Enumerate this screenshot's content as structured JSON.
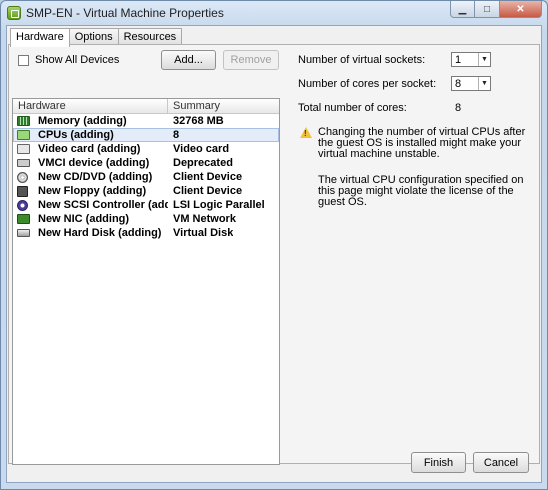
{
  "window": {
    "title": "SMP-EN - Virtual Machine Properties"
  },
  "tabs": [
    {
      "label": "Hardware"
    },
    {
      "label": "Options"
    },
    {
      "label": "Resources"
    }
  ],
  "hardware": {
    "show_all_devices_label": "Show All Devices",
    "add_button": "Add...",
    "remove_button": "Remove",
    "columns": {
      "hardware": "Hardware",
      "summary": "Summary"
    },
    "devices": [
      {
        "name": "Memory (adding)",
        "summary": "32768 MB",
        "icon": "memory-icon"
      },
      {
        "name": "CPUs (adding)",
        "summary": "8",
        "icon": "cpu-icon"
      },
      {
        "name": "Video card  (adding)",
        "summary": "Video card",
        "icon": "video-card-icon"
      },
      {
        "name": "VMCI device (adding)",
        "summary": "Deprecated",
        "icon": "vmci-device-icon"
      },
      {
        "name": "New CD/DVD (adding)",
        "summary": "Client Device",
        "icon": "cd-dvd-icon"
      },
      {
        "name": "New Floppy (adding)",
        "summary": "Client Device",
        "icon": "floppy-icon"
      },
      {
        "name": "New SCSI Controller (add...",
        "summary": "LSI Logic Parallel",
        "icon": "scsi-controller-icon"
      },
      {
        "name": "New NIC (adding)",
        "summary": "VM Network",
        "icon": "nic-icon"
      },
      {
        "name": "New Hard Disk (adding)",
        "summary": "Virtual Disk",
        "icon": "hard-disk-icon"
      }
    ]
  },
  "cpu_settings": {
    "sockets_label": "Number of virtual sockets:",
    "sockets_value": "1",
    "cores_label": "Number of cores per socket:",
    "cores_value": "8",
    "total_label": "Total number of cores:",
    "total_value": "8",
    "warning_text": "Changing the number of virtual CPUs after the guest OS is installed might make your virtual machine unstable.",
    "license_note": "The virtual CPU configuration specified on this page might violate the license of the guest OS."
  },
  "footer": {
    "finish_button": "Finish",
    "cancel_button": "Cancel"
  }
}
